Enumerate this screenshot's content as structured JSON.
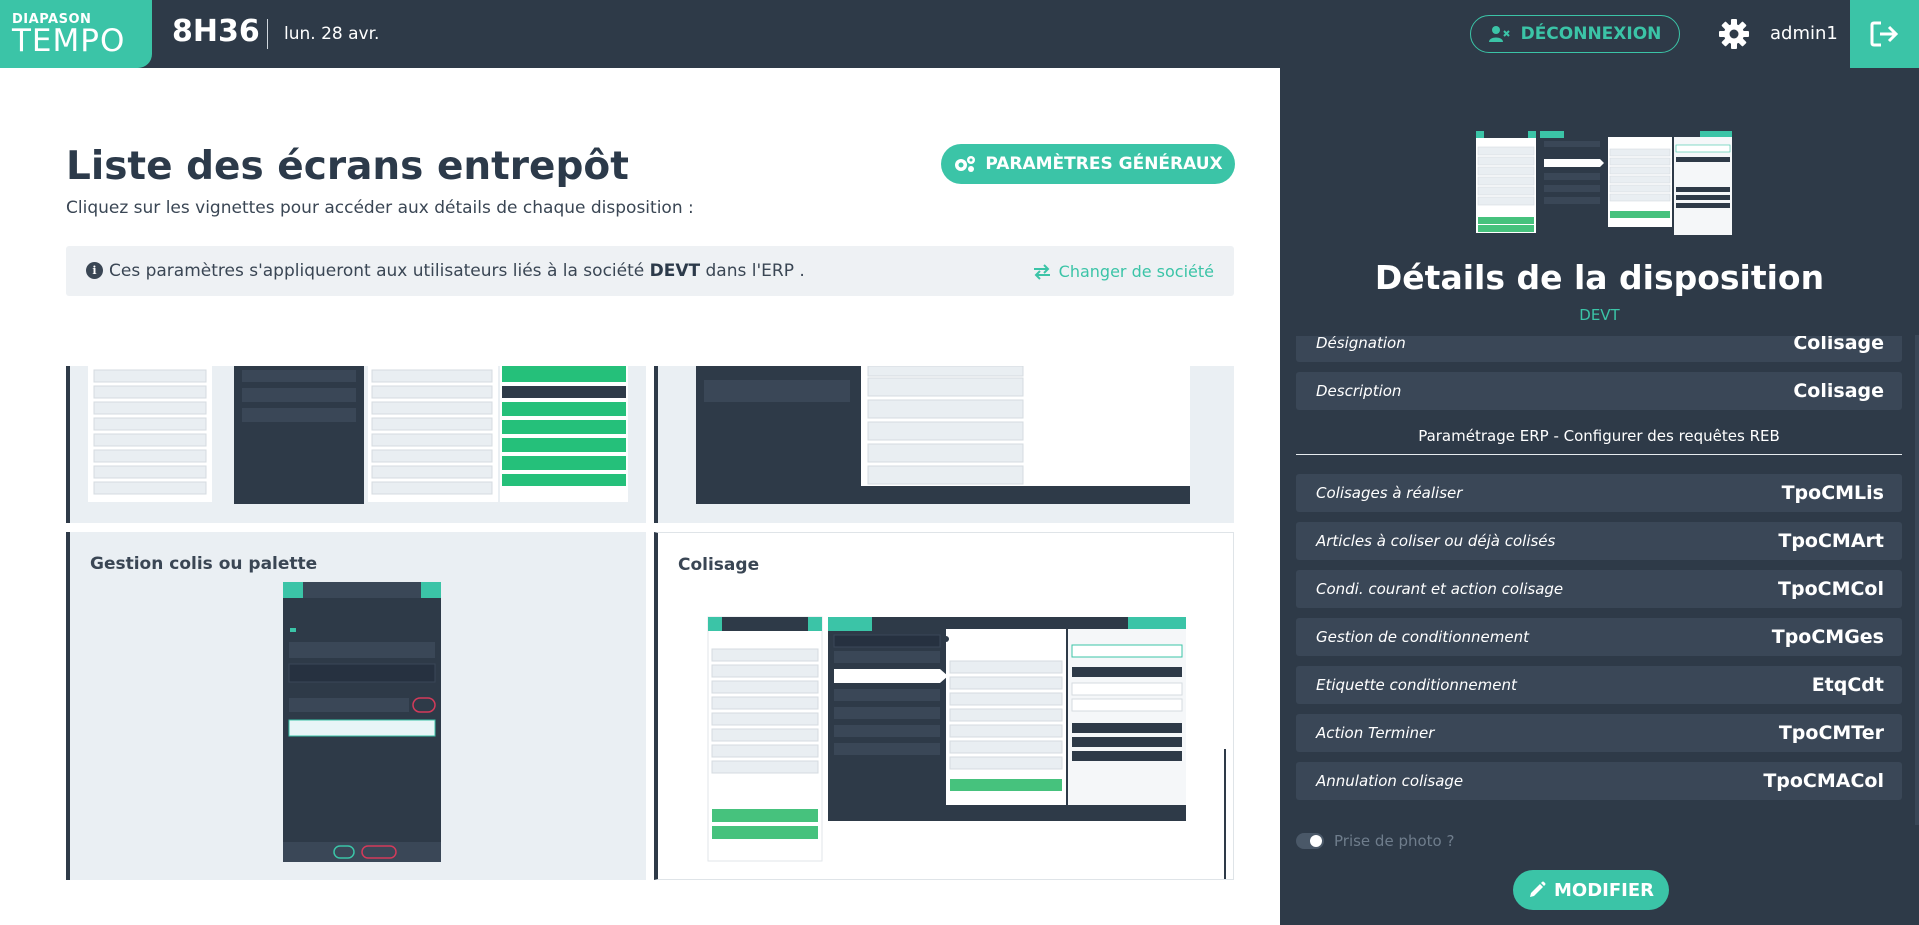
{
  "topbar": {
    "logo_small": "DIAPASON",
    "logo_big": "TEMPO",
    "clock": "8H36",
    "date": "lun. 28 avr.",
    "logout_label": "DÉCONNEXION",
    "username": "admin1"
  },
  "main": {
    "title": "Liste des écrans entrepôt",
    "subtitle": "Cliquez sur les vignettes pour accéder aux détails de chaque disposition :",
    "params_button": "PARAMÈTRES GÉNÉRAUX",
    "info": {
      "text_before": "Ces paramètres s'appliqueront aux utilisateurs liés à la société ",
      "company": "DEVT",
      "text_after": " dans l'ERP .",
      "change_company": "Changer de société"
    },
    "cards": [
      {
        "title": "Gestion colis ou palette"
      },
      {
        "title": "Colisage"
      }
    ]
  },
  "panel": {
    "title": "Détails de la disposition",
    "subtitle": "DEVT",
    "top_rows": [
      {
        "label": "Désignation",
        "value": "Colisage"
      },
      {
        "label": "Description",
        "value": "Colisage"
      }
    ],
    "erp_caption": "Paramétrage ERP - Configurer des requêtes REB",
    "erp_rows": [
      {
        "label": "Colisages à réaliser",
        "value": "TpoCMLis"
      },
      {
        "label": "Articles à coliser ou déjà colisés",
        "value": "TpoCMArt"
      },
      {
        "label": "Condi. courant et action colisage",
        "value": "TpoCMCol"
      },
      {
        "label": "Gestion de conditionnement",
        "value": "TpoCMGes"
      },
      {
        "label": "Etiquette conditionnement",
        "value": "EtqCdt"
      },
      {
        "label": "Action Terminer",
        "value": "TpoCMTer"
      },
      {
        "label": "Annulation colisage",
        "value": "TpoCMACol"
      }
    ],
    "photo_label": "Prise de photo ?",
    "modify_label": "MODIFIER"
  },
  "colors": {
    "accent": "#3bc4a7",
    "dark": "#2e3a48",
    "row_bg": "#3a4757",
    "light_bg": "#eef1f4"
  }
}
